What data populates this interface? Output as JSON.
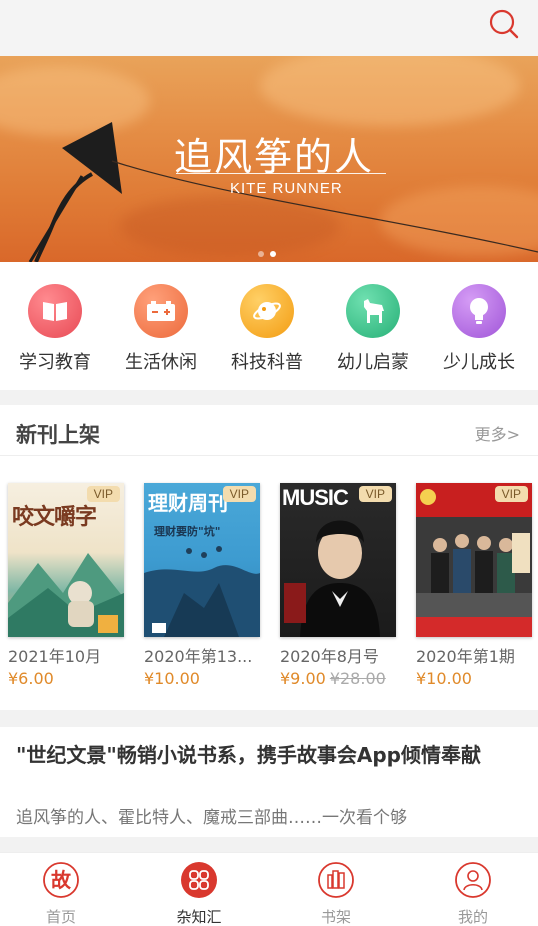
{
  "banner": {
    "title": "追风筝的人",
    "subtitle": "KITE RUNNER",
    "slide_count": 2,
    "active_slide": 2
  },
  "categories": [
    {
      "label": "学习教育",
      "icon": "book-icon",
      "color": "#ee5b63"
    },
    {
      "label": "生活休闲",
      "icon": "battery-icon",
      "color": "#f07a4f"
    },
    {
      "label": "科技科普",
      "icon": "planet-icon",
      "color": "#f5a623"
    },
    {
      "label": "幼儿启蒙",
      "icon": "horse-icon",
      "color": "#3fc28a"
    },
    {
      "label": "少儿成长",
      "icon": "lightbulb-icon",
      "color": "#b26ee0"
    }
  ],
  "new_arrivals": {
    "title": "新刊上架",
    "more": "更多>",
    "items": [
      {
        "name": "2021年10月",
        "price": "¥6.00",
        "vip": "VIP",
        "cover_text": "咬文嚼字"
      },
      {
        "name": "2020年第13...",
        "price": "¥10.00",
        "vip": "VIP",
        "cover_text": "理财周刊",
        "cover_sub": "理财要防\"坑\""
      },
      {
        "name": "2020年8月号",
        "price": "¥9.00",
        "orig_price": "¥28.00",
        "vip": "VIP",
        "cover_text": "MUSIC"
      },
      {
        "name": "2020年第1期",
        "price": "¥10.00",
        "vip": "VIP"
      }
    ]
  },
  "article": {
    "title": "\"世纪文景\"畅销小说书系，携手故事会App倾情奉献",
    "desc": "追风筝的人、霍比特人、魔戒三部曲……一次看个够"
  },
  "tabs": [
    {
      "label": "首页",
      "icon": "home-icon",
      "active": false
    },
    {
      "label": "杂知汇",
      "icon": "grid-icon",
      "active": true
    },
    {
      "label": "书架",
      "icon": "bookshelf-icon",
      "active": false
    },
    {
      "label": "我的",
      "icon": "profile-icon",
      "active": false
    }
  ],
  "colors": {
    "accent": "#d9382e",
    "price": "#e08a2a"
  }
}
